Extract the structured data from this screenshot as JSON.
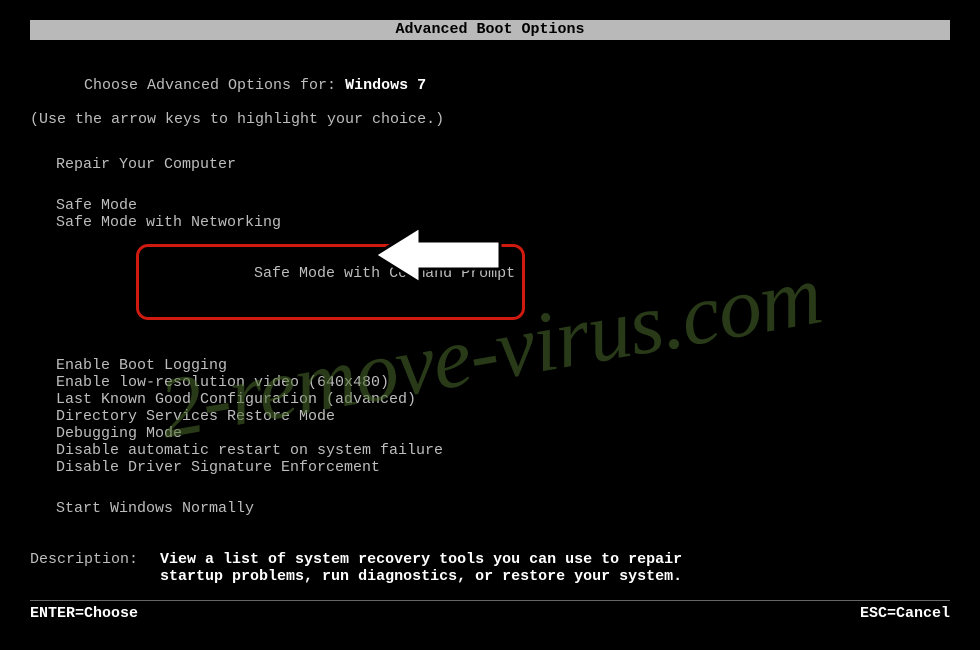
{
  "title": "Advanced Boot Options",
  "prompt_label": "Choose Advanced Options for: ",
  "os_name": "Windows 7",
  "hint": "(Use the arrow keys to highlight your choice.)",
  "menu": {
    "group1": [
      "Repair Your Computer"
    ],
    "group2": [
      "Safe Mode",
      "Safe Mode with Networking",
      "Safe Mode with Command Prompt"
    ],
    "group3": [
      "Enable Boot Logging",
      "Enable low-resolution video (640x480)",
      "Last Known Good Configuration (advanced)",
      "Directory Services Restore Mode",
      "Debugging Mode",
      "Disable automatic restart on system failure",
      "Disable Driver Signature Enforcement"
    ],
    "group4": [
      "Start Windows Normally"
    ],
    "highlighted": "Safe Mode with Command Prompt"
  },
  "description": {
    "label": "Description:",
    "text": "View a list of system recovery tools you can use to repair startup problems, run diagnostics, or restore your system."
  },
  "footer": {
    "enter": "ENTER=Choose",
    "esc": "ESC=Cancel"
  },
  "watermark": "2-remove-virus.com",
  "colors": {
    "highlight_ring": "#cf1a10",
    "watermark": "#4a6a2a"
  }
}
